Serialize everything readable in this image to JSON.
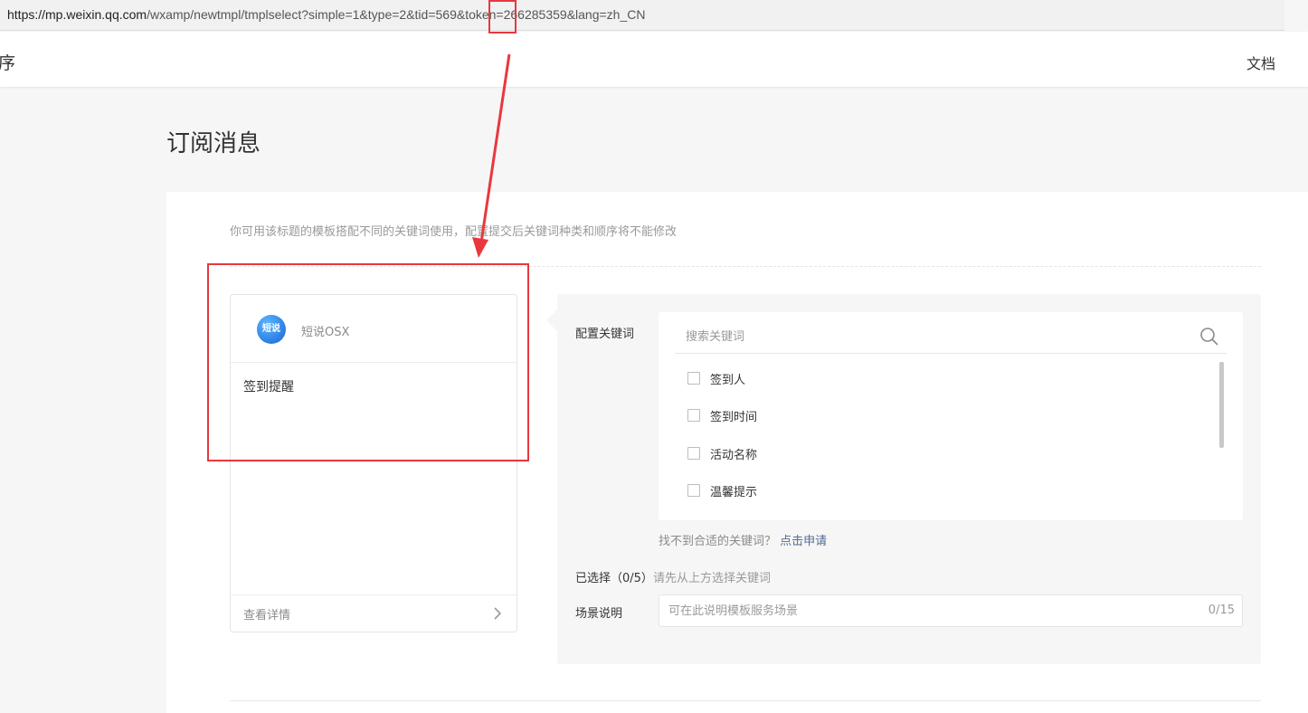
{
  "browser": {
    "url_host": "https://mp.weixin.qq.com",
    "url_path": "/wxamp/newtmpl/tmplselect?simple=1&type=2&tid=569&token=266285359&lang=zh_CN"
  },
  "nav": {
    "left_fragment": "序",
    "docs": "文档"
  },
  "page": {
    "title": "订阅消息",
    "hint": "你可用该标题的模板搭配不同的关键词使用，配置提交后关键词种类和顺序将不能修改"
  },
  "preview": {
    "avatar_text": "短说",
    "app_name": "短说OSX",
    "template_title": "签到提醒",
    "detail": "查看详情"
  },
  "config": {
    "keywords_label": "配置关键词",
    "search_placeholder": "搜索关键词",
    "keywords": [
      {
        "label": "签到人",
        "checked": false
      },
      {
        "label": "签到时间",
        "checked": false
      },
      {
        "label": "活动名称",
        "checked": false
      },
      {
        "label": "温馨提示",
        "checked": false
      }
    ],
    "not_found": "找不到合适的关键词？",
    "apply": "点击申请",
    "selected": "已选择（0/5）",
    "selected_tip": "请先从上方选择关键词",
    "scene_label": "场景说明",
    "scene_placeholder": "可在此说明模板服务场景",
    "scene_counter": "0/15"
  },
  "annotation_color": "#e8383d"
}
